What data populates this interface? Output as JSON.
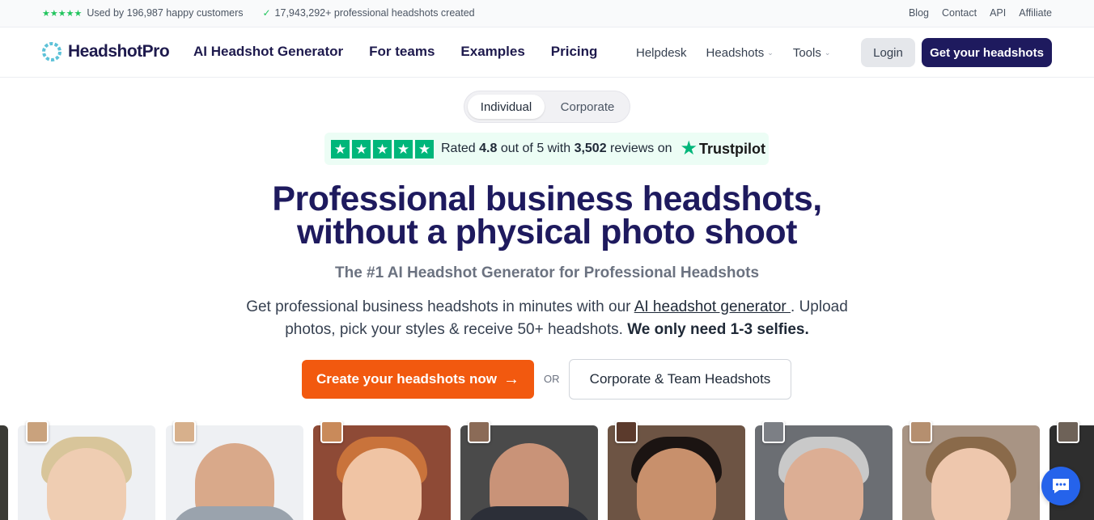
{
  "topbar": {
    "stars": "★★★★★",
    "customers_text": "Used by 196,987 happy customers",
    "check": "✓",
    "headshots_text": "17,943,292+ professional headshots created",
    "links": [
      "Blog",
      "Contact",
      "API",
      "Affiliate"
    ]
  },
  "nav": {
    "brand": "HeadshotPro",
    "main_links": [
      "AI Headshot Generator",
      "For teams",
      "Examples",
      "Pricing"
    ],
    "helpdesk": "Helpdesk",
    "headshots_menu": "Headshots",
    "tools_menu": "Tools",
    "login": "Login",
    "get_headshots": "Get your headshots"
  },
  "toggle": {
    "active": "Individual",
    "inactive": "Corporate"
  },
  "trustpilot": {
    "rated_prefix": "Rated ",
    "rating": "4.8",
    "out_of": " out of 5 with ",
    "reviews_count": "3,502",
    "reviews_suffix": " reviews on",
    "brand": "Trustpilot",
    "star_count_rendered": 5
  },
  "hero": {
    "title_line1": "Professional business headshots,",
    "title_line2": "without a physical photo shoot",
    "subtitle": "The #1 AI Headshot Generator for Professional Headshots",
    "desc_part1": "Get professional business headshots in minutes with our ",
    "desc_link": "AI headshot generator ",
    "desc_part2": ". Upload photos, pick your styles & receive 50+ headshots. ",
    "desc_bold": "We only need 1-3 selfies."
  },
  "cta": {
    "primary": "Create your headshots now",
    "arrow": "→",
    "or": "OR",
    "secondary": "Corporate & Team Headshots"
  },
  "colors": {
    "brand_navy": "#1e1a5e",
    "cta_orange": "#f2590f",
    "trustpilot_green": "#00b67a",
    "chat_blue": "#2563eb"
  }
}
